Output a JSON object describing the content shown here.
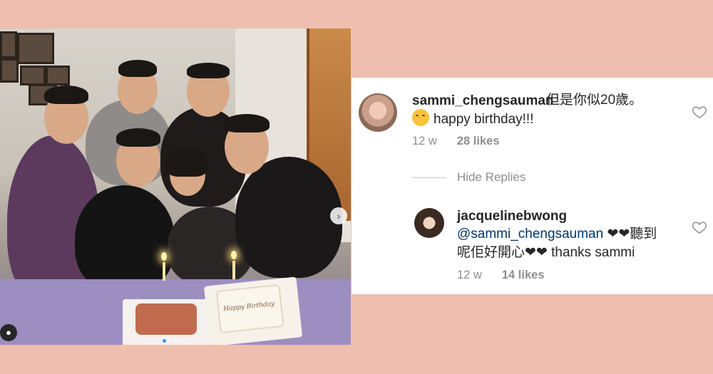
{
  "comments": [
    {
      "username": "sammi_chengsauman",
      "text_line1": "但是你似20歲。",
      "text_line2": "happy birthday!!!",
      "emoji_icon": "smiling-face-icon",
      "age": "12 w",
      "likes": "28 likes"
    }
  ],
  "hide_replies": "Hide Replies",
  "replies": [
    {
      "username": "jacquelinebwong",
      "mention": "@sammi_chengsauman",
      "text_line1_rest": " ❤❤聽到",
      "text_line2": "呢佢好開心❤❤ thanks sammi",
      "age": "12 w",
      "likes": "14 likes"
    }
  ],
  "photo": {
    "cake_text": "Happy Birthday",
    "carousel_active_index": 0,
    "carousel_count": 3
  },
  "icons": {
    "like": "heart-outline-icon",
    "next": "chevron-right-icon",
    "tag": "user-tag-icon"
  },
  "colors": {
    "page_bg": "#eebfae",
    "panel_bg": "#ffffff",
    "mention": "#003569",
    "meta": "#8e8e8e"
  }
}
